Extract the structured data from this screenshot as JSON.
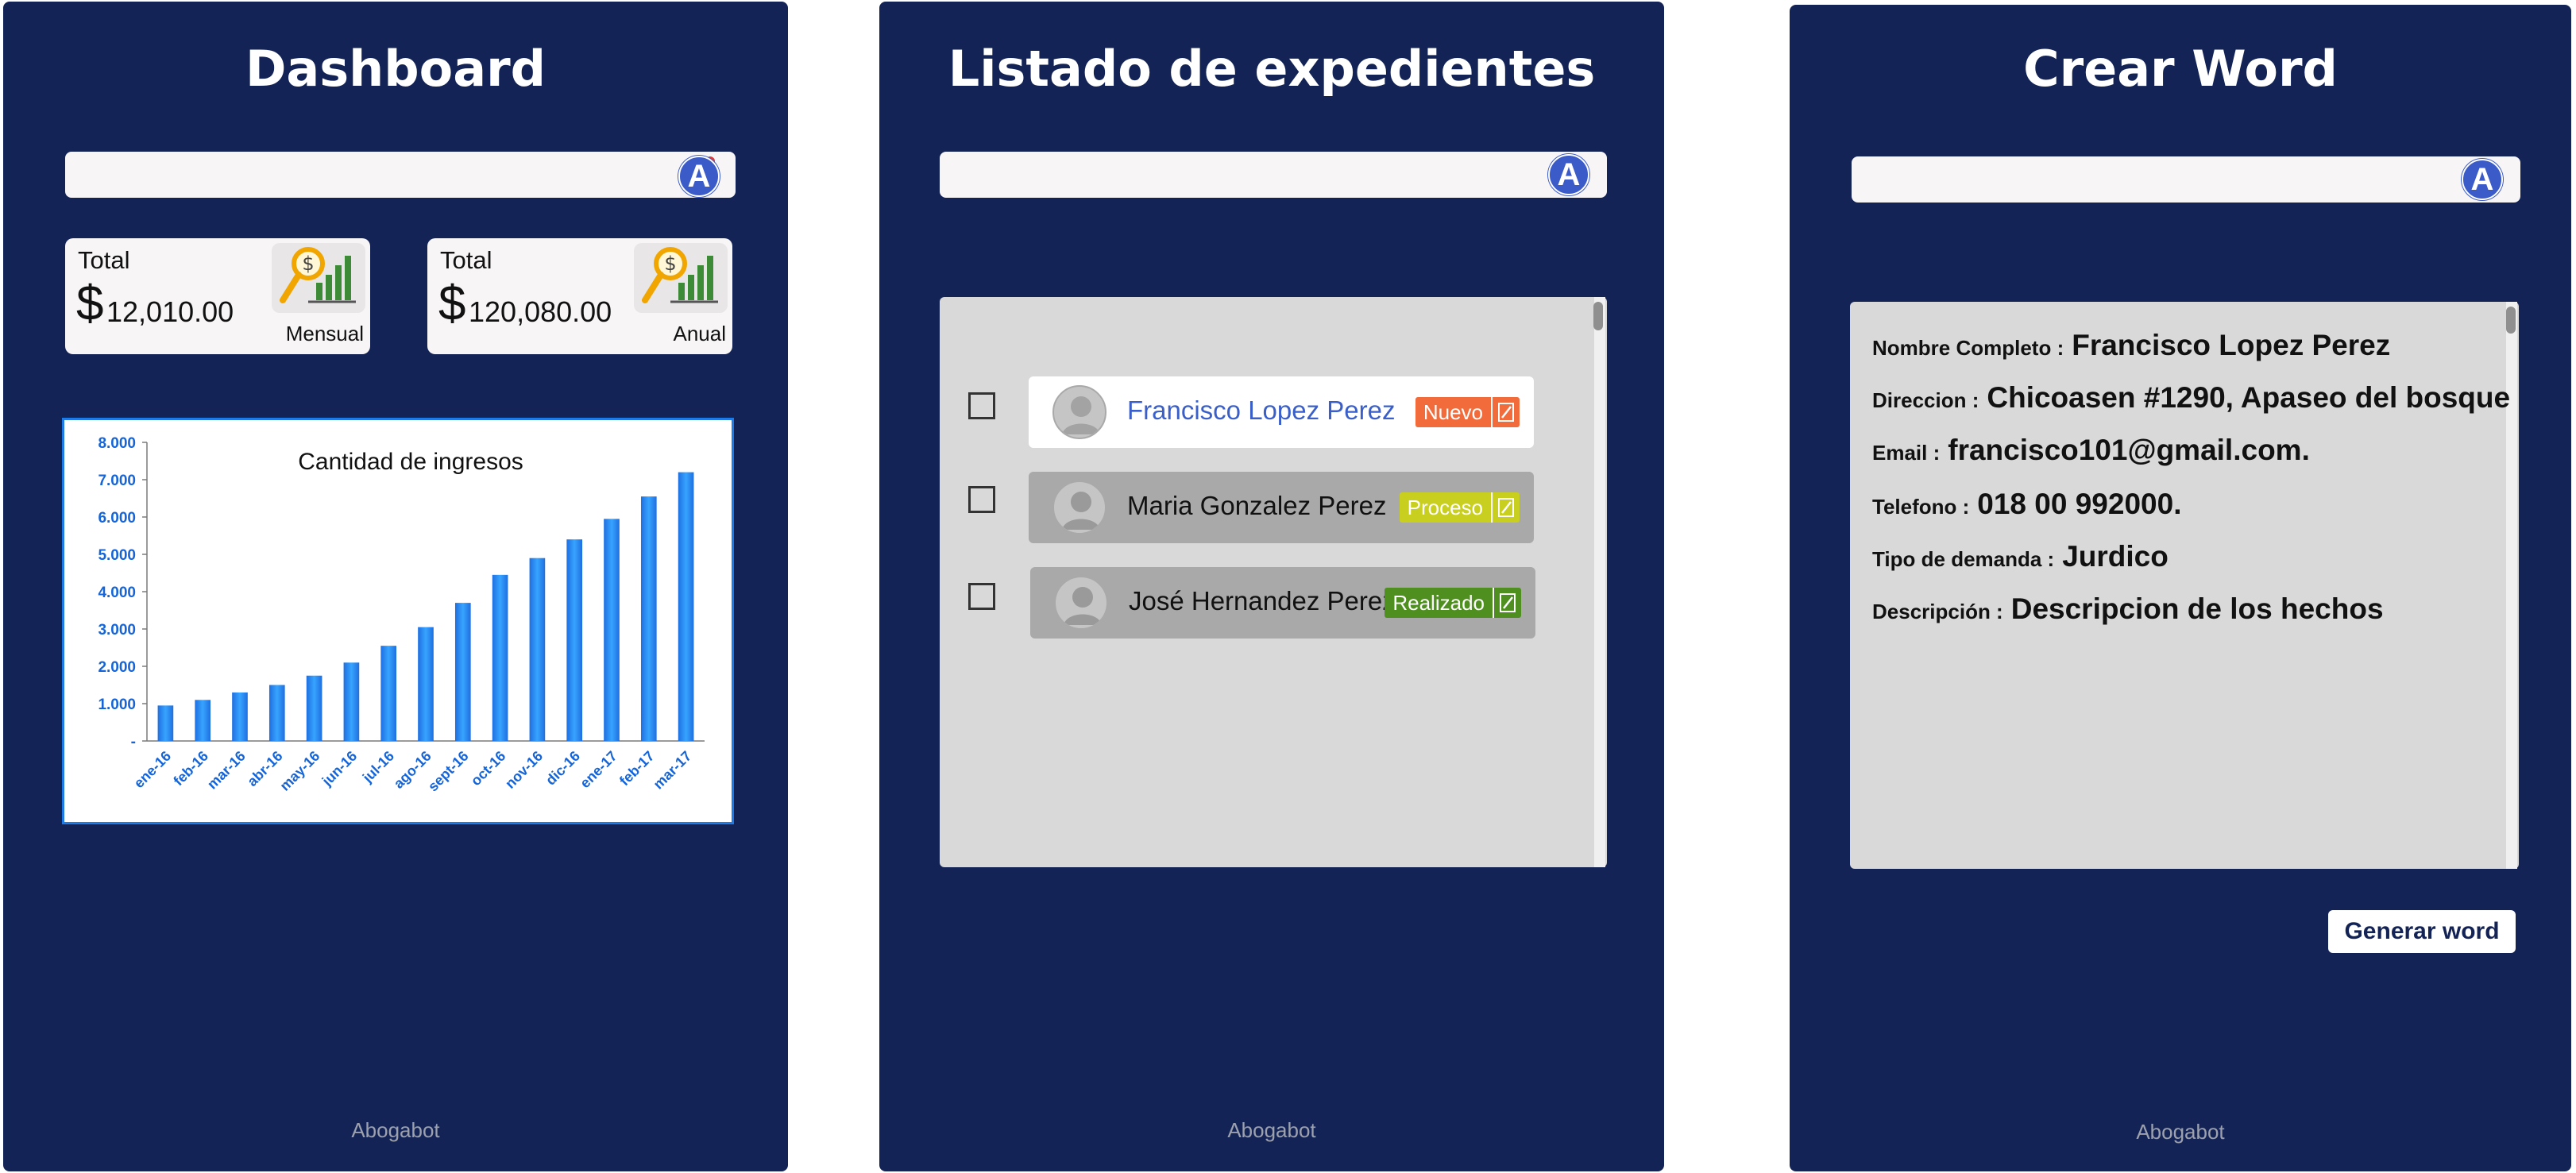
{
  "app_name": "Abogabot",
  "dashboard": {
    "title": "Dashboard",
    "cards": [
      {
        "label": "Total",
        "currency": "$",
        "amount": "12,010.00",
        "period": "Mensual"
      },
      {
        "label": "Total",
        "currency": "$",
        "amount": "120,080.00",
        "period": "Anual"
      }
    ]
  },
  "chart_data": {
    "type": "bar",
    "title": "Cantidad de ingresos",
    "categories": [
      "ene-16",
      "feb-16",
      "mar-16",
      "abr-16",
      "may-16",
      "jun-16",
      "jul-16",
      "ago-16",
      "sept-16",
      "oct-16",
      "nov-16",
      "dic-16",
      "ene-17",
      "feb-17",
      "mar-17"
    ],
    "values": [
      950,
      1100,
      1300,
      1500,
      1750,
      2100,
      2550,
      3050,
      3700,
      4450,
      4900,
      5400,
      5950,
      6550,
      7200
    ],
    "ylim": [
      0,
      8000
    ],
    "ytick_labels": [
      "-",
      "1.000",
      "2.000",
      "3.000",
      "4.000",
      "5.000",
      "6.000",
      "7.000",
      "8.000"
    ],
    "bar_color": "#1e7be6",
    "axis_label_color": "#1565d8"
  },
  "listing": {
    "title": "Listado de expedientes",
    "rows": [
      {
        "name": "Francisco Lopez Perez",
        "status": "Nuevo",
        "status_color": "#f26b3a"
      },
      {
        "name": "Maria Gonzalez Perez",
        "status": "Proceso",
        "status_color": "#c9cf1e"
      },
      {
        "name": "José Hernandez Perez",
        "status": "Realizado",
        "status_color": "#4e8f1f"
      }
    ]
  },
  "form": {
    "title": "Crear Word",
    "fields": [
      {
        "label": "Nombre Completo :",
        "value": "Francisco  Lopez Perez"
      },
      {
        "label": "Direccion :",
        "value": "Chicoasen #1290, Apaseo del bosque"
      },
      {
        "label": "Email :",
        "value": "francisco101@gmail.com."
      },
      {
        "label": "Telefono :",
        "value": "018 00 992000."
      },
      {
        "label": "Tipo de demanda :",
        "value": "Jurdico"
      },
      {
        "label": "Descripción :",
        "value": "Descripcion de los hechos"
      }
    ],
    "button_label": "Generar word"
  },
  "user_avatar_letter": "A"
}
